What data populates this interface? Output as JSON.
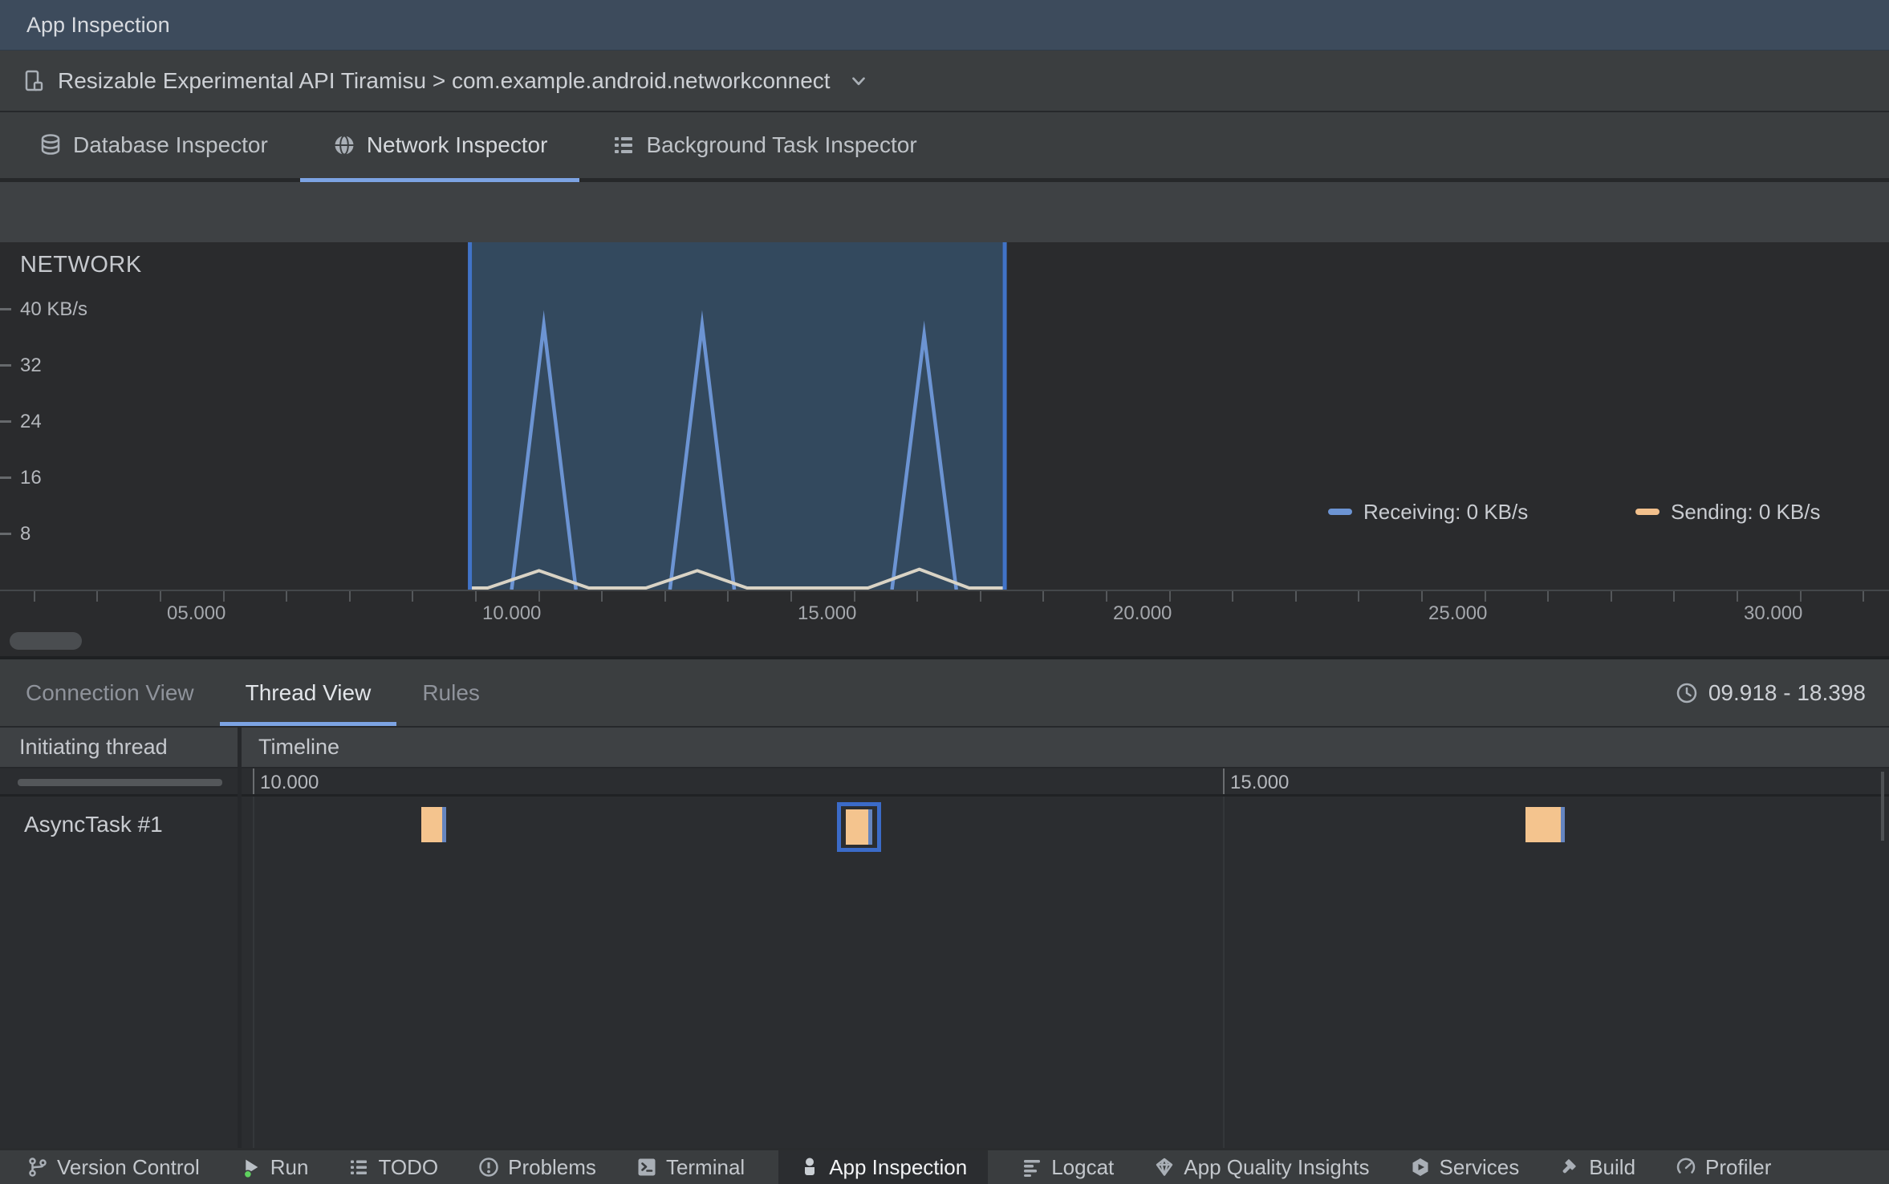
{
  "titlebar": {
    "title": "App Inspection"
  },
  "device_bar": {
    "label": "Resizable Experimental API Tiramisu > com.example.android.networkconnect",
    "icon": "resizable-device-icon",
    "dropdown_icon": "chevron-down-icon"
  },
  "inspector_tabs": [
    {
      "label": "Database Inspector",
      "icon": "database-icon",
      "active": false
    },
    {
      "label": "Network Inspector",
      "icon": "globe-icon",
      "active": true
    },
    {
      "label": "Background Task Inspector",
      "icon": "task-list-icon",
      "active": false
    }
  ],
  "chart": {
    "type": "line",
    "title": "NETWORK",
    "y_axis": {
      "unit": "KB/s",
      "labels": [
        {
          "text": "40 KB/s",
          "value": 40
        },
        {
          "text": "32",
          "value": 32
        },
        {
          "text": "24",
          "value": 24
        },
        {
          "text": "16",
          "value": 16
        },
        {
          "text": "8",
          "value": 8
        }
      ]
    },
    "x_axis": {
      "unit": "s",
      "minor_tick_interval_s": 1,
      "minor_start_s": 3,
      "minor_end_s": 32,
      "labels": [
        {
          "t": 5,
          "text": "05.000"
        },
        {
          "t": 10,
          "text": "10.000"
        },
        {
          "t": 15,
          "text": "15.000"
        },
        {
          "t": 20,
          "text": "20.000"
        },
        {
          "t": 25,
          "text": "25.000"
        },
        {
          "t": 30,
          "text": "30.000"
        }
      ]
    },
    "legend": [
      {
        "label": "Receiving: 0 KB/s",
        "color": "#6C94D3"
      },
      {
        "label": "Sending: 0 KB/s",
        "color": "#F2C08C"
      }
    ],
    "selection": {
      "start_s": 9.918,
      "end_s": 18.398
    },
    "series": {
      "receiving": {
        "name": "Receiving",
        "half_width_s": 0.51,
        "spikes": [
          {
            "peak_s": 11.09,
            "peak_kbps": 37.7
          },
          {
            "peak_s": 13.6,
            "peak_kbps": 37.7
          },
          {
            "peak_s": 17.12,
            "peak_kbps": 36.3
          }
        ]
      },
      "sending": {
        "name": "Sending",
        "bumps": [
          {
            "peak_s": 11.09,
            "peak_kbps": 2.7
          },
          {
            "peak_s": 13.6,
            "peak_kbps": 2.7
          },
          {
            "peak_s": 17.12,
            "peak_kbps": 2.9
          }
        ]
      }
    }
  },
  "bottom_panel": {
    "tabs": [
      {
        "label": "Connection View",
        "active": false
      },
      {
        "label": "Thread View",
        "active": true
      },
      {
        "label": "Rules",
        "active": false
      }
    ],
    "time_range": "09.918 - 18.398",
    "time_range_icon": "clock-icon",
    "table": {
      "columns": [
        "Initiating thread",
        "Timeline"
      ],
      "ruler_labels": [
        {
          "t": 10,
          "text": "10.000"
        },
        {
          "t": 15,
          "text": "15.000"
        }
      ],
      "rows": [
        {
          "thread": "AsyncTask #1",
          "blocks": [
            {
              "start_s": 10.868,
              "end_s": 10.976,
              "selected": false
            },
            {
              "start_s": 13.056,
              "end_s": 13.172,
              "selected": true
            },
            {
              "start_s": 16.559,
              "end_s": 16.741,
              "selected": false
            }
          ]
        }
      ]
    }
  },
  "status_bar": {
    "items": [
      {
        "label": "Version Control",
        "icon": "git-branch-icon",
        "active": false
      },
      {
        "label": "Run",
        "icon": "run-play-icon",
        "active": false
      },
      {
        "label": "TODO",
        "icon": "todo-list-icon",
        "active": false
      },
      {
        "label": "Problems",
        "icon": "problems-icon",
        "active": false
      },
      {
        "label": "Terminal",
        "icon": "terminal-icon",
        "active": false
      },
      {
        "label": "App Inspection",
        "icon": "app-inspection-icon",
        "active": true
      },
      {
        "label": "Logcat",
        "icon": "logcat-icon",
        "active": false
      },
      {
        "label": "App Quality Insights",
        "icon": "diamond-icon",
        "active": false
      },
      {
        "label": "Services",
        "icon": "services-hexagon-icon",
        "active": false
      },
      {
        "label": "Build",
        "icon": "hammer-icon",
        "active": false
      },
      {
        "label": "Profiler",
        "icon": "gauge-icon",
        "active": false
      }
    ]
  },
  "colors": {
    "titlebar_bg": "#3D4B5C",
    "accent_underline": "#7CA3E3",
    "selection_fill": "#33495E",
    "selection_border": "#4173C7",
    "receiving": "#6C94D3",
    "sending": "#F2C08C",
    "sending_line": "#D9D3C5",
    "thread_block": "#F4C48E",
    "thread_block_tail": "#6585C0",
    "thread_block_selected_outline": "#3B6BC8",
    "run_dot": "#5FD35F"
  }
}
